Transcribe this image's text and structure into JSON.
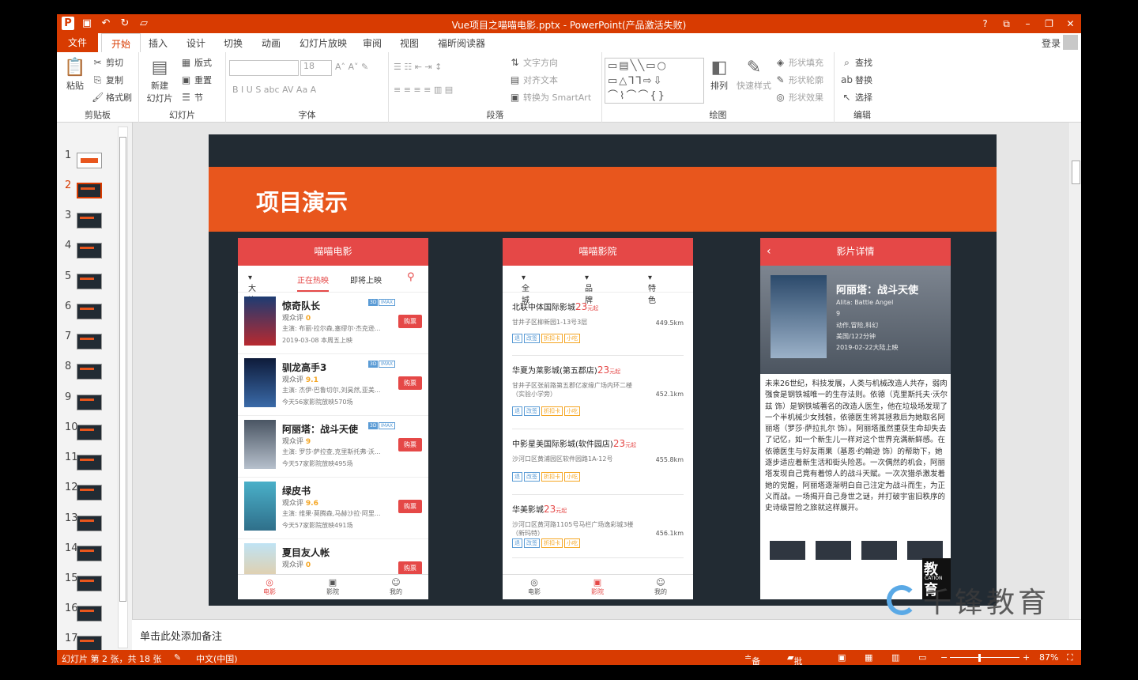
{
  "window": {
    "title": "Vue项目之喵喵电影.pptx - PowerPoint(产品激活失败)",
    "help": "?",
    "controls": [
      "?",
      "⧉",
      "–",
      "❐",
      "✕"
    ]
  },
  "ribbon_tabs": [
    "文件",
    "开始",
    "插入",
    "设计",
    "切换",
    "动画",
    "幻灯片放映",
    "审阅",
    "视图",
    "福昕阅读器"
  ],
  "account": {
    "login": "登录"
  },
  "clipboard": {
    "paste": "粘贴",
    "cut": "剪切",
    "copy": "复制",
    "format": "格式刷",
    "label": "剪贴板"
  },
  "slides_group": {
    "new": "新建",
    "new2": "幻灯片",
    "layout": "版式",
    "reset": "重置",
    "section": "节",
    "label": "幻灯片"
  },
  "font_group": {
    "size": "18",
    "label": "字体"
  },
  "paragraph": {
    "direction": "文字方向",
    "align": "对齐文本",
    "smartart": "转换为 SmartArt",
    "label": "段落"
  },
  "drawing": {
    "arrange": "排列",
    "quickstyle": "快速样式",
    "fill": "形状填充",
    "outline": "形状轮廓",
    "effect": "形状效果",
    "label": "绘图"
  },
  "editing": {
    "find": "查找",
    "replace": "替换",
    "select": "选择",
    "label": "编辑"
  },
  "thumbnails": [
    "1",
    "2",
    "3",
    "4",
    "5",
    "6",
    "7",
    "8",
    "9",
    "10",
    "11",
    "12",
    "13",
    "14",
    "15",
    "16",
    "17"
  ],
  "slide": {
    "title": "项目演示"
  },
  "phone1": {
    "header": "喵喵电影",
    "city": "大连",
    "tab_hot": "正在热映",
    "tab_soon": "即将上映",
    "score_label": "观众评",
    "movies": [
      {
        "name": "惊奇队长",
        "score": "0",
        "cast": "主演: 布丽·拉尔森,塞缪尔·杰克逊...",
        "info": "2019-03-08 本周五上映",
        "buy": "购票"
      },
      {
        "name": "驯龙高手3",
        "score": "9.1",
        "cast": "主演: 杰伊·巴鲁切尔,刘昊然,亚美...",
        "info": "今天56家影院放映570场",
        "buy": "购票"
      },
      {
        "name": "阿丽塔：战斗天使",
        "score": "9",
        "cast": "主演: 罗莎·萨拉查,克里斯托弗·沃...",
        "info": "今天57家影院放映495场",
        "buy": "购票"
      },
      {
        "name": "绿皮书",
        "score": "9.6",
        "cast": "主演: 维果·莫腾森,马赫沙拉·阿里...",
        "info": "今天57家影院放映491场",
        "buy": "购票"
      },
      {
        "name": "夏目友人帐",
        "score": "0",
        "cast": "",
        "info": "",
        "buy": "购票"
      }
    ],
    "tag3d": "3D",
    "tagimax": "IMAX",
    "tabs": [
      "电影",
      "影院",
      "我的"
    ]
  },
  "phone2": {
    "header": "喵喵影院",
    "filters": [
      "全城",
      "品牌",
      "特色"
    ],
    "price_unit": "元起",
    "cinemas": [
      {
        "name": "北联中体国际影城",
        "price": "23",
        "addr": "甘井子区柳新园1-13号3层",
        "dist": "449.5km"
      },
      {
        "name": "华夏为莱影城(第五郡店)",
        "price": "23",
        "addr": "甘井子区张前路第五郡亿家缘广场内环二楼（实验小学旁）",
        "dist": "452.1km"
      },
      {
        "name": "中影星美国际影城(软件园店)",
        "price": "23",
        "addr": "沙河口区黄浦园区软件园路1A-12号",
        "dist": "455.8km"
      },
      {
        "name": "华美影城",
        "price": "23",
        "addr": "沙河口区黄河路1105号马栏广场逸彩城3楼（新玛特）",
        "dist": "456.1km"
      }
    ],
    "tags": [
      "退",
      "改签",
      "折扣卡",
      "小吃"
    ],
    "tabs": [
      "电影",
      "影院",
      "我的"
    ]
  },
  "phone3": {
    "header": "影片详情",
    "title": "阿丽塔：战斗天使",
    "en": "Alita: Battle Angel",
    "score": "9",
    "genre": "动作,冒险,科幻",
    "region": "美国/122分钟",
    "date": "2019-02-22大陆上映",
    "synopsis": "未来26世纪，科技发展，人类与机械改造人共存，弱肉强食是钢铁城唯一的生存法则。依德（克里斯托夫·沃尔兹 饰）是钢铁城著名的改造人医生，他在垃圾场发现了一个半机械少女残骸，依德医生将其拯救后为她取名阿丽塔（罗莎·萨拉扎尔 饰）。阿丽塔虽然重获生命却失去了记忆，如一个新生儿一样对这个世界充满新鲜感。在依德医生与好友雨果（基恩·约翰逊 饰）的帮助下，她逐步适应着新生活和街头险恶。一次偶然的机会，阿丽塔发现自己竟有着惊人的战斗天赋。一次次猎杀激发着她的觉醒，阿丽塔逐渐明白自己注定为战斗而生，为正义而战。一场揭开自己身世之谜，并打破宇宙旧秩序的史诗级冒险之旅就这样展开。",
    "edu_partial": "教育",
    "edu_cation": "CATION"
  },
  "notes": "单击此处添加备注",
  "status": {
    "slide": "幻灯片 第 2 张，共 18 张",
    "lang": "中文(中国)",
    "notes": "备注",
    "comments": "批注",
    "zoom": "87%"
  },
  "watermark": "千锋教育",
  "colors": {
    "accent": "#d83b01",
    "slide_bg": "#222b33",
    "banner": "#e8561d",
    "phone_red": "#e54847"
  }
}
